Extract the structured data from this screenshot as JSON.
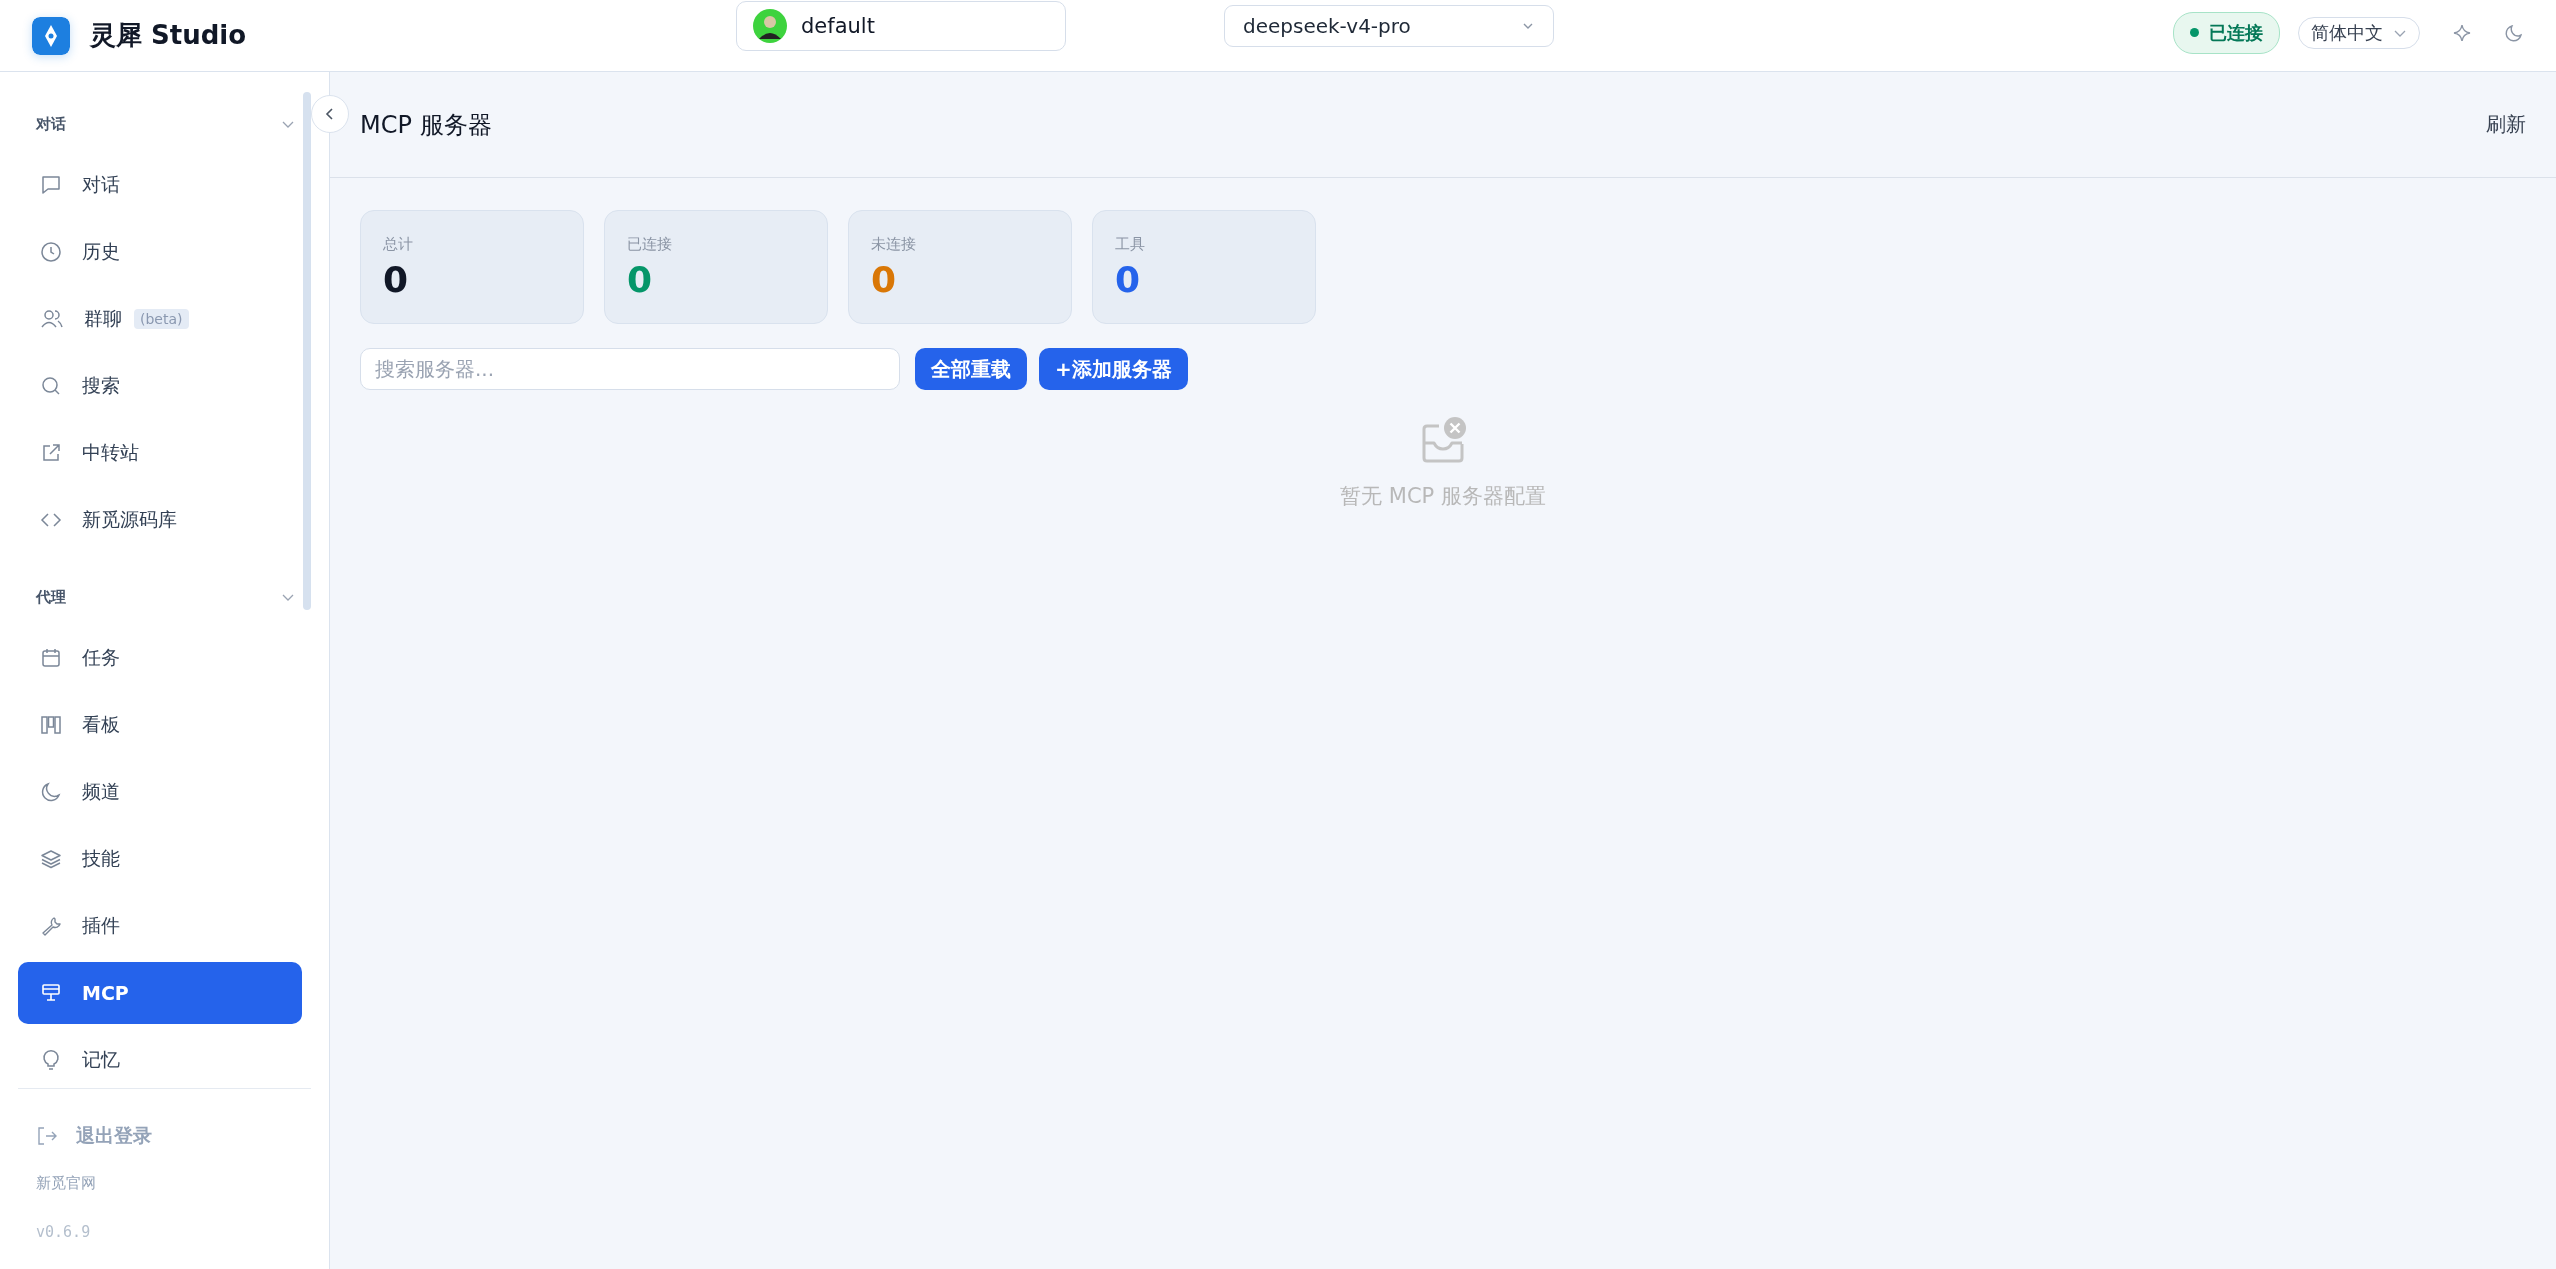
{
  "header": {
    "app_name": "灵犀 Studio",
    "profile": {
      "name": "default"
    },
    "model": {
      "value": "deepseek-v4-pro"
    },
    "status": {
      "label": "已连接",
      "connected": true
    },
    "language": {
      "value": "简体中文"
    }
  },
  "sidebar": {
    "sections": [
      {
        "title": "对话",
        "expanded": true,
        "items": [
          {
            "label": "对话",
            "kind": "chat",
            "selected": false
          },
          {
            "label": "历史",
            "kind": "clock",
            "selected": false
          },
          {
            "label": "群聊",
            "kind": "users",
            "badge": "(beta)",
            "selected": false
          },
          {
            "label": "搜索",
            "kind": "search",
            "selected": false
          },
          {
            "label": "中转站",
            "kind": "external",
            "selected": false
          },
          {
            "label": "新觅源码库",
            "kind": "code",
            "selected": false
          }
        ]
      },
      {
        "title": "代理",
        "expanded": true,
        "items": [
          {
            "label": "任务",
            "kind": "calendar",
            "selected": false
          },
          {
            "label": "看板",
            "kind": "kanban",
            "selected": false
          },
          {
            "label": "频道",
            "kind": "moon",
            "selected": false
          },
          {
            "label": "技能",
            "kind": "layers",
            "selected": false
          },
          {
            "label": "插件",
            "kind": "wrench",
            "selected": false
          },
          {
            "label": "MCP",
            "kind": "mcp",
            "selected": true
          },
          {
            "label": "记忆",
            "kind": "bulb",
            "selected": false
          }
        ]
      }
    ],
    "footer": {
      "logout": "退出登录",
      "website": "新觅官网",
      "version": "v0.6.9"
    }
  },
  "page": {
    "title": "MCP 服务器",
    "refresh": "刷新",
    "stats": [
      {
        "label": "总计",
        "value": "0",
        "color": "#111827"
      },
      {
        "label": "已连接",
        "value": "0",
        "color": "#059669"
      },
      {
        "label": "未连接",
        "value": "0",
        "color": "#d97706"
      },
      {
        "label": "工具",
        "value": "0",
        "color": "#2563eb"
      }
    ],
    "search": {
      "placeholder": "搜索服务器..."
    },
    "buttons": [
      "全部重载",
      "+添加服务器"
    ],
    "empty": "暂无 MCP 服务器配置"
  }
}
